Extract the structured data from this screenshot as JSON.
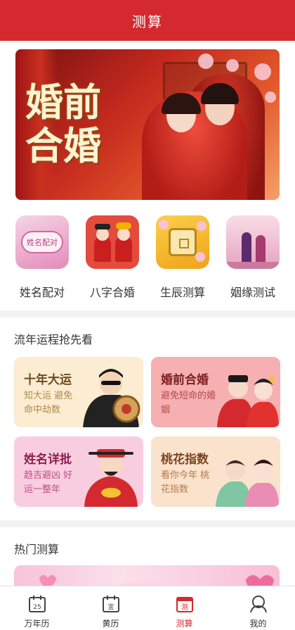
{
  "header": {
    "title": "测算"
  },
  "banner": {
    "title": "婚前合婚"
  },
  "categories": [
    {
      "label": "姓名配对",
      "icon": "name-pairing-icon",
      "badge": "姓名配对"
    },
    {
      "label": "八字合婚",
      "icon": "bazi-marriage-icon"
    },
    {
      "label": "生辰测算",
      "icon": "birth-calc-icon"
    },
    {
      "label": "姻缘测试",
      "icon": "marriage-fate-icon"
    }
  ],
  "fortune": {
    "title": "流年运程抢先看",
    "cards": [
      {
        "title": "十年大运",
        "subtitle": "知大运 避免命中劫数"
      },
      {
        "title": "婚前合婚",
        "subtitle": "避免短命的婚姻"
      },
      {
        "title": "姓名详批",
        "subtitle": "趋吉避凶 好运一整年"
      },
      {
        "title": "桃花指数",
        "subtitle": "看你今年 桃花指数"
      }
    ]
  },
  "hot": {
    "title": "热门测算"
  },
  "tabs": [
    {
      "label": "万年历",
      "icon": "calendar-icon",
      "badge": "25"
    },
    {
      "label": "黄历",
      "icon": "almanac-icon",
      "badge": "宜"
    },
    {
      "label": "测算",
      "icon": "divination-icon",
      "badge": "测"
    },
    {
      "label": "我的",
      "icon": "user-icon"
    }
  ],
  "colors": {
    "primary": "#d42a2f"
  }
}
